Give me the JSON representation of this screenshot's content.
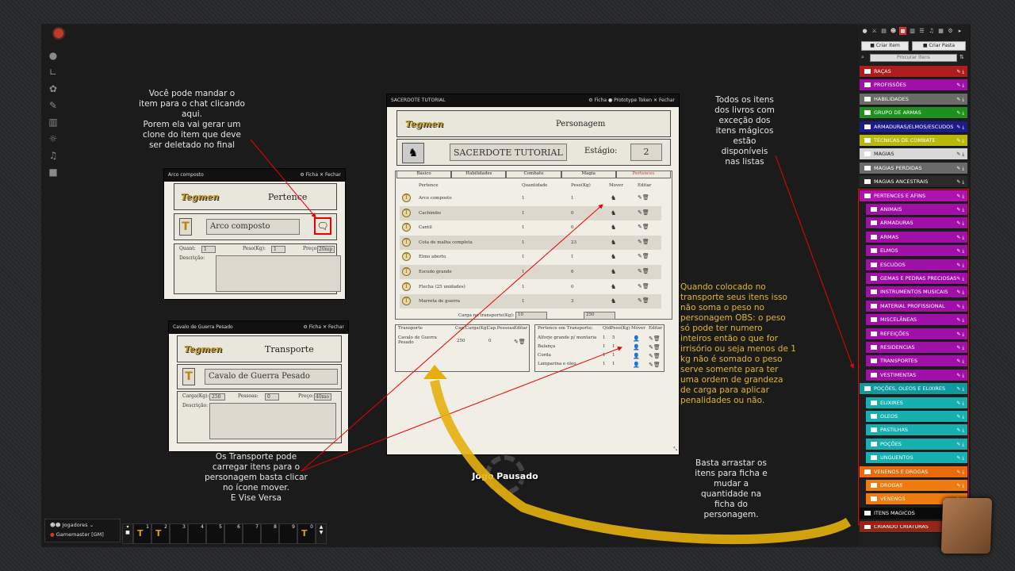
{
  "notes": {
    "chat": "Você pode mandar o\nitem para o chat clicando\naqui.\nPorem ela vai gerar um\nclone do item que deve\nser deletado no final",
    "books": "Todos os itens\ndos livros com\nexceção dos\nitens mágicos\nestão disponíveis\nnas listas",
    "transport": "Quando colocado no\ntransporte seus itens isso\nnão soma o peso no\npersonagem OBS: o peso\nsó pode ter numero\ninteiros então o que for\nirrisório ou seja menos de 1\nkg não é somado o peso\nserve somente para ter\numa ordem de grandeza\nde carga para aplicar\npenalidades ou não.",
    "carry": "Os Transporte pode\ncarregar itens para o\npersonagem basta clicar\nno ícone mover.\nE Vise Versa",
    "drag": "Basta arrastar os\nitens para ficha e\nmudar a\nquantidade na\nficha do\npersonagem."
  },
  "item_win": {
    "title": "Arco composto",
    "ficha": "Ficha",
    "fechar": "Fechar",
    "logo": "Tegmen",
    "section": "Pertence",
    "name": "Arco composto",
    "quant_label": "Quant:",
    "quant": "1",
    "peso_label": "Peso(Kg):",
    "peso": "1",
    "preco_label": "Preço:",
    "preco": "20mp",
    "desc_label": "Descrição:"
  },
  "transp_win": {
    "title": "Cavalo de Guerra Pesado",
    "ficha": "Ficha",
    "fechar": "Fechar",
    "logo": "Tegmen",
    "section": "Transporte",
    "name": "Cavalo de Guerra Pesado",
    "carga_label": "Carga(Kg):",
    "carga": "250",
    "pessoas_label": "Pessoas:",
    "pessoas": "0",
    "preco_label": "Preço:",
    "preco": "40mo",
    "desc_label": "Descrição:"
  },
  "sheet": {
    "title": "SACERDOTE TUTORIAL",
    "ficha": "Ficha",
    "proto": "Prototype Token",
    "fechar": "Fechar",
    "logo": "Tegmen",
    "header": "Personagem",
    "char_name": "SACERDOTE TUTORIAL",
    "estagio_label": "Estágio:",
    "estagio": "2",
    "tabs": [
      "Básico",
      "Habilidades",
      "Combate",
      "Magia",
      "Pertences"
    ],
    "cols": {
      "pertence": "Pertence",
      "quant": "Quantidade",
      "peso": "Peso(Kg)",
      "mover": "Mover",
      "editar": "Editar"
    },
    "items": [
      {
        "name": "Arco composto",
        "q": "1",
        "p": "1"
      },
      {
        "name": "Cachimbo",
        "q": "1",
        "p": "0"
      },
      {
        "name": "Cantil",
        "q": "1",
        "p": "0"
      },
      {
        "name": "Cota de malha completa",
        "q": "1",
        "p": "23"
      },
      {
        "name": "Elmo aberto",
        "q": "1",
        "p": "1"
      },
      {
        "name": "Escudo grande",
        "q": "1",
        "p": "6"
      },
      {
        "name": "Flecha (25 unidades)",
        "q": "1",
        "p": "0"
      },
      {
        "name": "Marreta de guerra",
        "q": "1",
        "p": "3"
      }
    ],
    "carga_label": "Carga no transporte(Kg):",
    "carga1": "10",
    "carga2": "250",
    "t_cols": {
      "transporte": "Transporte",
      "cap": "Cap.Carga(Kg)",
      "pess": "Cap.Pessoas",
      "editar": "Editar"
    },
    "t_row": {
      "name": "Cavalo de Guerra Pesado",
      "cap": "250",
      "pess": "0"
    },
    "pt_cols": {
      "pertence": "Pertence em Transporte:",
      "qtd": "Qtd",
      "peso": "Peso(Kg)",
      "mover": "Mover",
      "editar": "Editar"
    },
    "pt_items": [
      {
        "name": "Alforje grande p/ montaria",
        "q": "1",
        "p": "5"
      },
      {
        "name": "Balança",
        "q": "1",
        "p": "1"
      },
      {
        "name": "Corda",
        "q": "1",
        "p": "1"
      },
      {
        "name": "Lamparina e óleo",
        "q": "1",
        "p": "1"
      }
    ]
  },
  "paused": "Jogo Pausado",
  "players": {
    "title": "Jogadores",
    "gm": "Gamemaster [GM]"
  },
  "hotbar": [
    "1",
    "2",
    "3",
    "4",
    "5",
    "6",
    "7",
    "8",
    "9",
    "0"
  ],
  "sidebar": {
    "create_item": "Criar Item",
    "create_folder": "Criar Pasta",
    "search": "Procurar Itens",
    "folders": [
      {
        "label": "RAÇAS",
        "color": "#b01c1c",
        "ind": 0
      },
      {
        "label": "PROFISSÕES",
        "color": "#a010a8",
        "ind": 0
      },
      {
        "label": "HABILIDADES",
        "color": "#6a6a6a",
        "ind": 0
      },
      {
        "label": "GRUPO DE ARMAS",
        "color": "#1f8f1f",
        "ind": 0
      },
      {
        "label": "ARMADURAS/ELMOS/ESCUDOS",
        "color": "#1b1b8a",
        "ind": 0
      },
      {
        "label": "TÉCNICAS DE COMBATE",
        "color": "#b8b80a",
        "ind": 0
      },
      {
        "label": "MAGIAS",
        "color": "#d8d8d8",
        "ind": 0
      },
      {
        "label": "MAGIAS PERDIDAS",
        "color": "#6a6a6a",
        "ind": 0
      },
      {
        "label": "MAGIAS ANCESTRAIS",
        "color": "#2a2a2a",
        "ind": 0
      },
      {
        "label": "PERTENCES E AFINS",
        "color": "#b012b0",
        "ind": 0
      },
      {
        "label": "ANIMAIS",
        "color": "#a010a8",
        "ind": 1
      },
      {
        "label": "ARMADURAS",
        "color": "#a010a8",
        "ind": 1
      },
      {
        "label": "ARMAS",
        "color": "#a010a8",
        "ind": 1
      },
      {
        "label": "ELMOS",
        "color": "#a010a8",
        "ind": 1
      },
      {
        "label": "ESCUDOS",
        "color": "#a010a8",
        "ind": 1
      },
      {
        "label": "GEMAS E PEDRAS PRECIOSAS",
        "color": "#a010a8",
        "ind": 1
      },
      {
        "label": "INSTRUMENTOS MUSICAIS",
        "color": "#a010a8",
        "ind": 1
      },
      {
        "label": "MATERIAL PROFISSIONAL",
        "color": "#a010a8",
        "ind": 1
      },
      {
        "label": "MISCELÂNEAS",
        "color": "#a010a8",
        "ind": 1
      },
      {
        "label": "REFEIÇÕES",
        "color": "#a010a8",
        "ind": 1
      },
      {
        "label": "RESIDENCIAS",
        "color": "#a010a8",
        "ind": 1
      },
      {
        "label": "TRANSPORTES",
        "color": "#a010a8",
        "ind": 1
      },
      {
        "label": "VESTIMENTAS",
        "color": "#a010a8",
        "ind": 1
      },
      {
        "label": "POÇÕES, OLEOS E ELIXIRES",
        "color": "#0e9aa0",
        "ind": 0
      },
      {
        "label": "ELIXIRES",
        "color": "#16b0b0",
        "ind": 1
      },
      {
        "label": "OLEOS",
        "color": "#16b0b0",
        "ind": 1
      },
      {
        "label": "PASTILHAS",
        "color": "#16b0b0",
        "ind": 1
      },
      {
        "label": "POÇÕES",
        "color": "#16b0b0",
        "ind": 1
      },
      {
        "label": "UNGUENTOS",
        "color": "#16b0b0",
        "ind": 1
      },
      {
        "label": "VENENOS E DROGAS",
        "color": "#e86a0a",
        "ind": 0
      },
      {
        "label": "DROGAS",
        "color": "#ee7a10",
        "ind": 1
      },
      {
        "label": "VENENOS",
        "color": "#ee7a10",
        "ind": 1
      },
      {
        "label": "ITENS MAGICOS",
        "color": "#0a0a0a",
        "ind": 0
      },
      {
        "label": "CRIANDO CRIATURAS",
        "color": "#8a2a1a",
        "ind": 0
      }
    ]
  }
}
